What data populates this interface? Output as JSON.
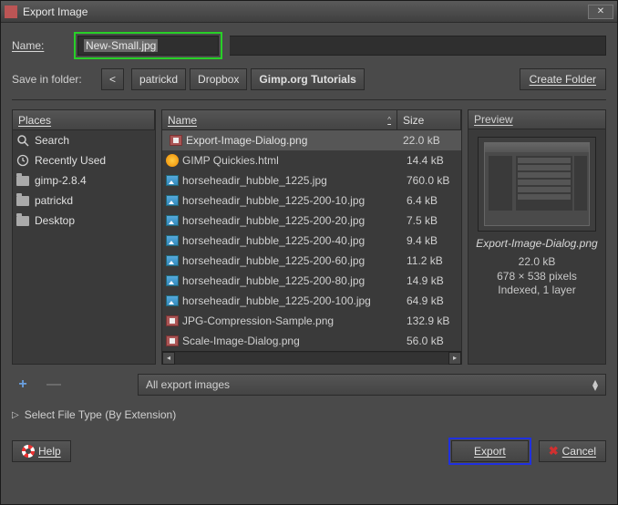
{
  "window": {
    "title": "Export Image"
  },
  "name": {
    "label": "Name:",
    "value": "New-Small.jpg"
  },
  "save_in": {
    "label": "Save in folder:",
    "back": "<",
    "segments": [
      "patrickd",
      "Dropbox",
      "Gimp.org Tutorials"
    ],
    "create_folder": "Create Folder"
  },
  "places": {
    "header": "Places",
    "items": [
      {
        "kind": "search",
        "label": "Search"
      },
      {
        "kind": "recent",
        "label": "Recently Used"
      },
      {
        "kind": "folder",
        "label": "gimp-2.8.4"
      },
      {
        "kind": "folder",
        "label": "patrickd"
      },
      {
        "kind": "folder",
        "label": "Desktop"
      }
    ]
  },
  "files": {
    "col_name": "Name",
    "col_size": "Size",
    "rows": [
      {
        "icon": "png",
        "name": "Export-Image-Dialog.png",
        "size": "22.0 kB",
        "sel": true
      },
      {
        "icon": "html",
        "name": "GIMP Quickies.html",
        "size": "14.4 kB"
      },
      {
        "icon": "img",
        "name": "horseheadir_hubble_1225.jpg",
        "size": "760.0 kB"
      },
      {
        "icon": "img",
        "name": "horseheadir_hubble_1225-200-10.jpg",
        "size": "6.4 kB"
      },
      {
        "icon": "img",
        "name": "horseheadir_hubble_1225-200-20.jpg",
        "size": "7.5 kB"
      },
      {
        "icon": "img",
        "name": "horseheadir_hubble_1225-200-40.jpg",
        "size": "9.4 kB"
      },
      {
        "icon": "img",
        "name": "horseheadir_hubble_1225-200-60.jpg",
        "size": "11.2 kB"
      },
      {
        "icon": "img",
        "name": "horseheadir_hubble_1225-200-80.jpg",
        "size": "14.9 kB"
      },
      {
        "icon": "img",
        "name": "horseheadir_hubble_1225-200-100.jpg",
        "size": "64.9 kB"
      },
      {
        "icon": "png",
        "name": "JPG-Compression-Sample.png",
        "size": "132.9 kB"
      },
      {
        "icon": "png",
        "name": "Scale-Image-Dialog.png",
        "size": "56.0 kB"
      }
    ]
  },
  "preview": {
    "header": "Preview",
    "filename": "Export-Image-Dialog.png",
    "size": "22.0 kB",
    "dims": "678 × 538 pixels",
    "mode": "Indexed, 1 layer"
  },
  "filter": {
    "label": "All export images"
  },
  "expander": {
    "label": "Select File Type (By Extension)"
  },
  "buttons": {
    "help": "Help",
    "export": "Export",
    "cancel": "Cancel"
  }
}
